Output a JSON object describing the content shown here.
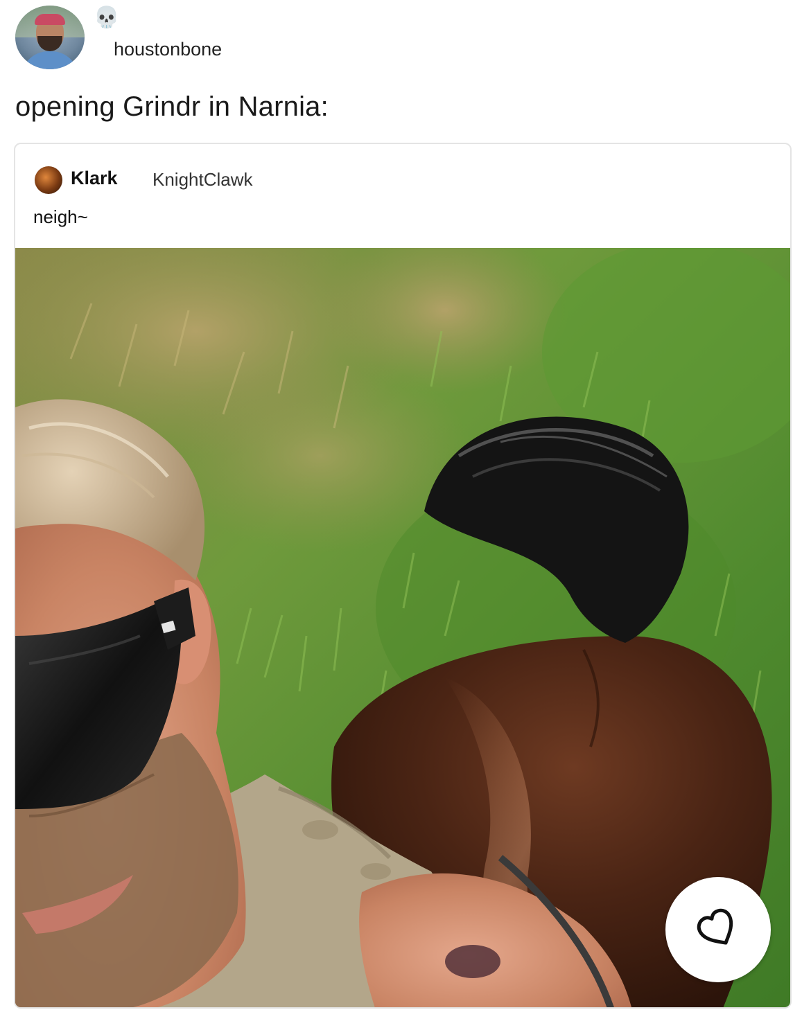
{
  "post": {
    "username": "houstonbone",
    "badge_icon": "skull-icon",
    "caption": "opening Grindr in Narnia:"
  },
  "embed": {
    "name": "Klark",
    "handle": "KnightClawk",
    "text": "neigh~",
    "like_icon": "heart-icon"
  },
  "colors": {
    "card_border": "#e4e4e4",
    "text": "#222222"
  }
}
